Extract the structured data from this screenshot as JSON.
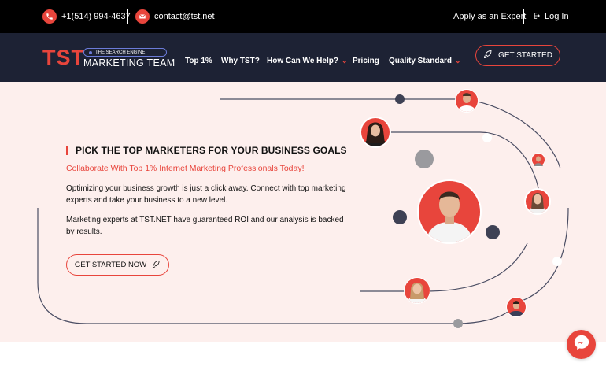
{
  "colors": {
    "accent": "#e8453c",
    "nav_bg": "#1d2234",
    "topbar_bg": "#000000",
    "hero_bg": "#fdefed"
  },
  "topbar": {
    "phone": {
      "icon": "phone-icon",
      "text": "+1(514) 994-4637"
    },
    "email": {
      "icon": "envelope-icon",
      "text": "contact@tst.net"
    },
    "apply": "Apply as an Expert",
    "login": {
      "icon": "sign-in-icon",
      "text": "Log In"
    }
  },
  "nav": {
    "logo": {
      "mark": "TST",
      "tagline": "THE SEARCH ENGINE",
      "name": "MARKETING TEAM"
    },
    "links": [
      {
        "label": "Top 1%",
        "dropdown": false
      },
      {
        "label": "Why TST?",
        "dropdown": false
      },
      {
        "label": "How Can We Help?",
        "dropdown": true
      },
      {
        "label": "Pricing",
        "dropdown": false
      },
      {
        "label": "Quality Standard",
        "dropdown": true
      }
    ],
    "cta": {
      "label": "GET STARTED",
      "icon": "rocket-icon"
    }
  },
  "hero": {
    "title": "PICK THE TOP MARKETERS FOR YOUR BUSINESS GOALS",
    "subtitle": "Collaborate With Top 1% Internet Marketing Professionals Today!",
    "paragraph1": "Optimizing your business growth is just a click away. Connect with top marketing experts and take your business to a new level.",
    "paragraph2": "Marketing experts at TST.NET have guaranteed ROI and our analysis is backed by results.",
    "cta": {
      "label": "GET STARTED NOW",
      "icon": "rocket-icon"
    }
  },
  "chat": {
    "icon": "messenger-icon"
  }
}
